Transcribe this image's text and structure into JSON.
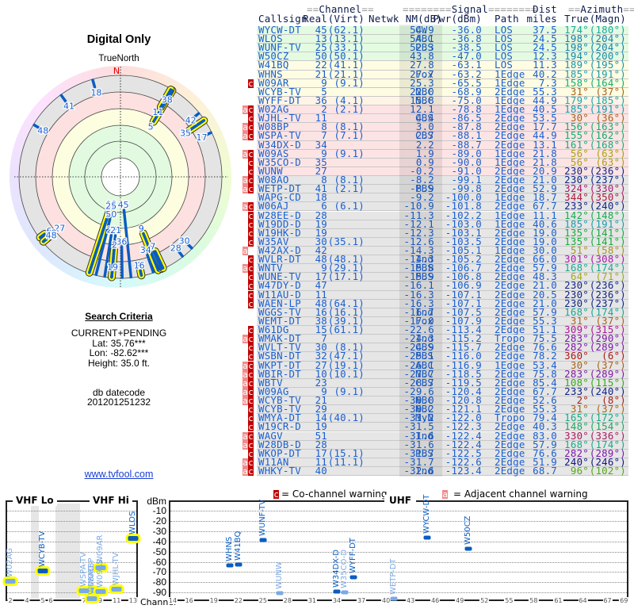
{
  "left": {
    "title": "Digital Only",
    "north_label": "TrueNorth",
    "north_letter": "N",
    "search_title": "Search Criteria",
    "mode": "CURRENT+PENDING",
    "lat": "Lat: 35.76***",
    "lon": "Lon: -82.62***",
    "height": "Height: 35.0 ft.",
    "db_label": "db datecode",
    "db_value": "201201251232",
    "link": "www.tvfool.com"
  },
  "header": {
    "eq_short": "==",
    "eq_long": "========",
    "channel": "Channel",
    "signal": "Signal",
    "dist": "Dist",
    "azimuth": "Azimuth",
    "callsign": "Callsign",
    "real": "Real",
    "virt": "(Virt)",
    "netwk": "Netwk",
    "nm": "NM(dB)",
    "pwr": "Pwr(dBm)",
    "path": "Path",
    "miles": "miles",
    "true": "True",
    "magn": "(Magn)"
  },
  "colors": {
    "link": "#1a5fd0",
    "co_channel": "#c00000",
    "adjacent": "#f08a8a",
    "bar": "#0a5cc2",
    "vhf_glow": "#ffff00"
  },
  "stations": [
    {
      "call": "WYCW-DT",
      "real": "45",
      "virt": "(62.1)",
      "netwk": "CW",
      "nm": "54.9",
      "pwr": "-36.0",
      "path": "LOS",
      "dist": "37.5",
      "true": "174°",
      "magn": "(180°)",
      "flags": ""
    },
    {
      "call": "WLOS",
      "real": "13",
      "virt": "(13.1)",
      "netwk": "ABC",
      "nm": "54.1",
      "pwr": "-36.8",
      "path": "LOS",
      "dist": "24.5",
      "true": "198°",
      "magn": "(204°)",
      "flags": ""
    },
    {
      "call": "WUNF-TV",
      "real": "25",
      "virt": "(33.1)",
      "netwk": "PBS",
      "nm": "52.3",
      "pwr": "-38.5",
      "path": "LOS",
      "dist": "24.5",
      "true": "198°",
      "magn": "(204°)",
      "flags": ""
    },
    {
      "call": "W50CZ",
      "real": "50",
      "virt": "(50.1)",
      "netwk": "",
      "nm": "43.8",
      "pwr": "-47.0",
      "path": "LOS",
      "dist": "12.3",
      "true": "194°",
      "magn": "(200°)",
      "flags": ""
    },
    {
      "call": "W41BQ",
      "real": "22",
      "virt": "(41.1)",
      "netwk": "",
      "nm": "27.8",
      "pwr": "-63.1",
      "path": "LOS",
      "dist": "11.3",
      "true": "189°",
      "magn": "(195°)",
      "flags": ""
    },
    {
      "call": "WHNS",
      "real": "21",
      "virt": "(21.1)",
      "netwk": "Fox",
      "nm": "27.7",
      "pwr": "-63.2",
      "path": "1Edge",
      "dist": "40.2",
      "true": "185°",
      "magn": "(191°)",
      "flags": ""
    },
    {
      "call": "W09AR",
      "real": "9",
      "virt": "(9.1)",
      "netwk": "",
      "nm": "25.3",
      "pwr": "-65.5",
      "path": "1Edge",
      "dist": "7.3",
      "true": "158°",
      "magn": "(164°)",
      "flags": "c"
    },
    {
      "call": "WCYB-TV",
      "real": "5",
      "virt": "",
      "netwk": "NBC",
      "nm": "22.0",
      "pwr": "-68.9",
      "path": "2Edge",
      "dist": "55.3",
      "true": "31°",
      "magn": "(37°)",
      "flags": ""
    },
    {
      "call": "WYFF-DT",
      "real": "36",
      "virt": "(4.1)",
      "netwk": "NBC",
      "nm": "15.8",
      "pwr": "-75.0",
      "path": "1Edge",
      "dist": "44.9",
      "true": "179°",
      "magn": "(185°)",
      "flags": ""
    },
    {
      "call": "W02AG",
      "real": "2",
      "virt": "(2.1)",
      "netwk": "",
      "nm": "12.1",
      "pwr": "-78.8",
      "path": "1Edge",
      "dist": "40.5",
      "true": "185°",
      "magn": "(191°)",
      "flags": "ac"
    },
    {
      "call": "WJHL-TV",
      "real": "11",
      "virt": "",
      "netwk": "CBS",
      "nm": "4.4",
      "pwr": "-86.5",
      "path": "2Edge",
      "dist": "53.5",
      "true": "30°",
      "magn": "(36°)",
      "flags": "c"
    },
    {
      "call": "W08BP",
      "real": "8",
      "virt": "(8.1)",
      "netwk": "",
      "nm": "3.0",
      "pwr": "-87.8",
      "path": "2Edge",
      "dist": "17.7",
      "true": "156°",
      "magn": "(163°)",
      "flags": "ac"
    },
    {
      "call": "WSPA-TV",
      "real": "7",
      "virt": "(7.1)",
      "netwk": "CBS",
      "nm": "2.7",
      "pwr": "-88.1",
      "path": "2Edge",
      "dist": "44.9",
      "true": "155°",
      "magn": "(162°)",
      "flags": "ac"
    },
    {
      "call": "W34DX-D",
      "real": "34",
      "virt": "",
      "netwk": "",
      "nm": "2.2",
      "pwr": "-88.7",
      "path": "2Edge",
      "dist": "13.1",
      "true": "161°",
      "magn": "(168°)",
      "flags": ""
    },
    {
      "call": "W09AS",
      "real": "9",
      "virt": "(9.1)",
      "netwk": "",
      "nm": "1.9",
      "pwr": "-89.0",
      "path": "1Edge",
      "dist": "21.8",
      "true": "56°",
      "magn": "(63°)",
      "flags": "ac"
    },
    {
      "call": "W35CO-D",
      "real": "35",
      "virt": "",
      "netwk": "",
      "nm": "0.9",
      "pwr": "-90.0",
      "path": "1Edge",
      "dist": "21.8",
      "true": "56°",
      "magn": "(63°)",
      "flags": "c"
    },
    {
      "call": "WUNW",
      "real": "27",
      "virt": "",
      "netwk": "",
      "nm": "-0.2",
      "pwr": "-91.0",
      "path": "2Edge",
      "dist": "20.9",
      "true": "230°",
      "magn": "(236°)",
      "flags": "c"
    },
    {
      "call": "W08AO",
      "real": "8",
      "virt": "(8.1)",
      "netwk": "",
      "nm": "-8.2",
      "pwr": "-99.1",
      "path": "2Edge",
      "dist": "21.0",
      "true": "230°",
      "magn": "(237°)",
      "flags": "ac"
    },
    {
      "call": "WETP-DT",
      "real": "41",
      "virt": "(2.1)",
      "netwk": "PBS",
      "nm": "-8.9",
      "pwr": "-99.8",
      "path": "2Edge",
      "dist": "52.9",
      "true": "324°",
      "magn": "(330°)",
      "flags": "ac"
    },
    {
      "call": "WAPG-CD",
      "real": "18",
      "virt": "",
      "netwk": "",
      "nm": "-9.2",
      "pwr": "-100.0",
      "path": "1Edge",
      "dist": "18.7",
      "true": "344°",
      "magn": "(350°)",
      "flags": ""
    },
    {
      "call": "W06AJ",
      "real": "6",
      "virt": "(6.1)",
      "netwk": "",
      "nm": "-10.9",
      "pwr": "-101.8",
      "path": "2Edge",
      "dist": "67.7",
      "true": "233°",
      "magn": "(240°)",
      "flags": "ac"
    },
    {
      "call": "W28EE-D",
      "real": "28",
      "virt": "",
      "netwk": "",
      "nm": "-11.3",
      "pwr": "-102.2",
      "path": "1Edge",
      "dist": "11.1",
      "true": "142°",
      "magn": "(148°)",
      "flags": "c"
    },
    {
      "call": "W19DD-D",
      "real": "19",
      "virt": "",
      "netwk": "",
      "nm": "-12.1",
      "pwr": "-103.0",
      "path": "1Edge",
      "dist": "40.6",
      "true": "185°",
      "magn": "(191°)",
      "flags": "c"
    },
    {
      "call": "W19HK-D",
      "real": "19",
      "virt": "",
      "netwk": "",
      "nm": "-12.3",
      "pwr": "-103.1",
      "path": "2Edge",
      "dist": "19.0",
      "true": "135°",
      "magn": "(141°)",
      "flags": "c"
    },
    {
      "call": "W35AV",
      "real": "30",
      "virt": "(35.1)",
      "netwk": "",
      "nm": "-12.6",
      "pwr": "-103.5",
      "path": "2Edge",
      "dist": "19.0",
      "true": "135°",
      "magn": "(141°)",
      "flags": "c"
    },
    {
      "call": "W42AX-D",
      "real": "42",
      "virt": "",
      "netwk": "",
      "nm": "-14.3",
      "pwr": "-105.1",
      "path": "1Edge",
      "dist": "30.0",
      "true": "51°",
      "magn": "(58°)",
      "flags": "a"
    },
    {
      "call": "WVLR-DT",
      "real": "48",
      "virt": "(48.1)",
      "netwk": "Ind",
      "nm": "-14.3",
      "pwr": "-105.2",
      "path": "2Edge",
      "dist": "66.0",
      "true": "301°",
      "magn": "(308°)",
      "flags": "c"
    },
    {
      "call": "WNTV",
      "real": "9",
      "virt": "(29.1)",
      "netwk": "PBS",
      "nm": "-15.8",
      "pwr": "-106.7",
      "path": "2Edge",
      "dist": "57.9",
      "true": "168°",
      "magn": "(174°)",
      "flags": "ac"
    },
    {
      "call": "WUNE-TV",
      "real": "17",
      "virt": "(17.1)",
      "netwk": "PBS",
      "nm": "-15.9",
      "pwr": "-106.8",
      "path": "2Edge",
      "dist": "48.3",
      "true": "64°",
      "magn": "(71°)",
      "flags": "c"
    },
    {
      "call": "W47DY-D",
      "real": "47",
      "virt": "",
      "netwk": "",
      "nm": "-16.1",
      "pwr": "-106.9",
      "path": "2Edge",
      "dist": "21.0",
      "true": "230°",
      "magn": "(236°)",
      "flags": "c"
    },
    {
      "call": "W11AU-D",
      "real": "11",
      "virt": "",
      "netwk": "",
      "nm": "-16.3",
      "pwr": "-107.1",
      "path": "2Edge",
      "dist": "20.5",
      "true": "230°",
      "magn": "(236°)",
      "flags": "c"
    },
    {
      "call": "WAEN-LP",
      "real": "48",
      "virt": "(64.1)",
      "netwk": "",
      "nm": "-16.3",
      "pwr": "-107.1",
      "path": "2Edge",
      "dist": "21.0",
      "true": "230°",
      "magn": "(237°)",
      "flags": "c"
    },
    {
      "call": "WGGS-TV",
      "real": "16",
      "virt": "(16.1)",
      "netwk": "Ind",
      "nm": "-16.7",
      "pwr": "-107.5",
      "path": "2Edge",
      "dist": "57.9",
      "true": "168°",
      "magn": "(174°)",
      "flags": ""
    },
    {
      "call": "WEMT-DT",
      "real": "38",
      "virt": "(39.1)",
      "netwk": "Fox",
      "nm": "-17.0",
      "pwr": "-107.9",
      "path": "2Edge",
      "dist": "55.3",
      "true": "31°",
      "magn": "(37°)",
      "flags": ""
    },
    {
      "call": "W61DG",
      "real": "15",
      "virt": "(61.1)",
      "netwk": "",
      "nm": "-22.6",
      "pwr": "-113.4",
      "path": "2Edge",
      "dist": "51.1",
      "true": "309°",
      "magn": "(315°)",
      "flags": "c"
    },
    {
      "call": "WMAK-DT",
      "real": "7",
      "virt": "",
      "netwk": "Ind",
      "nm": "-24.3",
      "pwr": "-115.2",
      "path": "Tropo",
      "dist": "75.5",
      "true": "283°",
      "magn": "(290°)",
      "flags": "ac"
    },
    {
      "call": "WVLT-TV",
      "real": "30",
      "virt": "(8.1)",
      "netwk": "CBS",
      "nm": "-24.9",
      "pwr": "-115.7",
      "path": "2Edge",
      "dist": "76.6",
      "true": "282°",
      "magn": "(289°)",
      "flags": "c"
    },
    {
      "call": "WSBN-DT",
      "real": "32",
      "virt": "(47.1)",
      "netwk": "PBS",
      "nm": "-25.1",
      "pwr": "-116.0",
      "path": "2Edge",
      "dist": "78.2",
      "true": "360°",
      "magn": "(6°)",
      "flags": "c"
    },
    {
      "call": "WKPT-DT",
      "real": "27",
      "virt": "(19.1)",
      "netwk": "ABC",
      "nm": "-26.1",
      "pwr": "-116.9",
      "path": "1Edge",
      "dist": "53.4",
      "true": "30°",
      "magn": "(37°)",
      "flags": "ac"
    },
    {
      "call": "WBIR-DT",
      "real": "10",
      "virt": "(10.1)",
      "netwk": "NBC",
      "nm": "-27.7",
      "pwr": "-118.5",
      "path": "2Edge",
      "dist": "75.8",
      "true": "283°",
      "magn": "(289°)",
      "flags": "ac"
    },
    {
      "call": "WBTV",
      "real": "23",
      "virt": "",
      "netwk": "CBS",
      "nm": "-28.7",
      "pwr": "-119.5",
      "path": "2Edge",
      "dist": "85.4",
      "true": "108°",
      "magn": "(115°)",
      "flags": "ac"
    },
    {
      "call": "W09AG",
      "real": "9",
      "virt": "(9.1)",
      "netwk": "",
      "nm": "-29.6",
      "pwr": "-120.4",
      "path": "2Edge",
      "dist": "67.7",
      "true": "233°",
      "magn": "(240°)",
      "flags": "ac"
    },
    {
      "call": "WCYB-TV",
      "real": "21",
      "virt": "",
      "netwk": "NBC",
      "nm": "-30.0",
      "pwr": "-120.8",
      "path": "2Edge",
      "dist": "52.6",
      "true": "2°",
      "magn": "(8°)",
      "flags": "ac"
    },
    {
      "call": "WCYB-TV",
      "real": "29",
      "virt": "",
      "netwk": "NBC",
      "nm": "-30.2",
      "pwr": "-121.1",
      "path": "2Edge",
      "dist": "55.3",
      "true": "31°",
      "magn": "(37°)",
      "flags": "c"
    },
    {
      "call": "WMYA-DT",
      "real": "14",
      "virt": "(40.1)",
      "netwk": "MyN",
      "nm": "-31.2",
      "pwr": "-122.0",
      "path": "Tropo",
      "dist": "79.4",
      "true": "165°",
      "magn": "(172°)",
      "flags": "c"
    },
    {
      "call": "W19CR-D",
      "real": "19",
      "virt": "",
      "netwk": "",
      "nm": "-31.5",
      "pwr": "-122.3",
      "path": "2Edge",
      "dist": "40.3",
      "true": "148°",
      "magn": "(154°)",
      "flags": "c"
    },
    {
      "call": "WAGV",
      "real": "51",
      "virt": "",
      "netwk": "Ind",
      "nm": "-31.6",
      "pwr": "-122.4",
      "path": "2Edge",
      "dist": "83.0",
      "true": "330°",
      "magn": "(336°)",
      "flags": "ac"
    },
    {
      "call": "W28DB-D",
      "real": "28",
      "virt": "",
      "netwk": "",
      "nm": "-31.6",
      "pwr": "-122.4",
      "path": "2Edge",
      "dist": "57.9",
      "true": "168°",
      "magn": "(174°)",
      "flags": "ac"
    },
    {
      "call": "WKOP-DT",
      "real": "17",
      "virt": "(15.1)",
      "netwk": "PBS",
      "nm": "-31.7",
      "pwr": "-122.5",
      "path": "2Edge",
      "dist": "76.6",
      "true": "282°",
      "magn": "(289°)",
      "flags": "c"
    },
    {
      "call": "W11AN",
      "real": "11",
      "virt": "(11.1)",
      "netwk": "",
      "nm": "-31.7",
      "pwr": "-122.6",
      "path": "2Edge",
      "dist": "51.9",
      "true": "240°",
      "magn": "(246°)",
      "flags": "ac"
    },
    {
      "call": "WHKY-TV",
      "real": "40",
      "virt": "",
      "netwk": "Ind",
      "nm": "-32.6",
      "pwr": "-123.4",
      "path": "2Edge",
      "dist": "68.7",
      "true": "96°",
      "magn": "(102°)",
      "flags": "ac"
    }
  ],
  "spectrum": {
    "legend_c_badge": "c",
    "legend_c": "= Co-channel warning",
    "legend_a_badge": "a",
    "legend_a": "= Adjacent channel warning",
    "vhf_lo": "VHF Lo",
    "vhf_hi": "VHF Hi",
    "uhf": "UHF",
    "unit": "dBm",
    "channel_label": "Channel",
    "dbm_ticks": [
      "-10",
      "-20",
      "-30",
      "-40",
      "-50",
      "-60",
      "-70",
      "-80",
      "-90"
    ],
    "vhf_ticks": [
      "2",
      "4",
      "5",
      "6",
      "7",
      "9",
      "11",
      "13"
    ],
    "uhf_ticks": [
      "14",
      "16",
      "19",
      "22",
      "25",
      "28",
      "31",
      "34",
      "37",
      "40",
      "43",
      "46",
      "49",
      "52",
      "55",
      "58",
      "61",
      "64",
      "67",
      "69"
    ]
  }
}
